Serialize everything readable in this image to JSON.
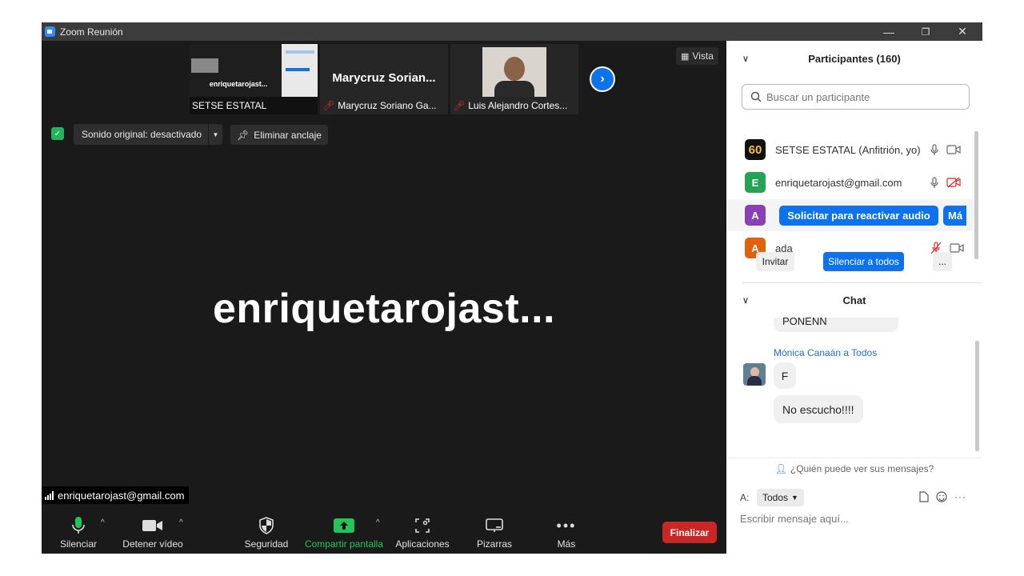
{
  "window": {
    "title": "Zoom Reunión",
    "min": "—",
    "restore": "❐",
    "close": "✕"
  },
  "gallery": {
    "thumbs": [
      {
        "caption": "SETSE ESTATAL",
        "screen_text": "enriquetarojast..."
      },
      {
        "name_big": "Marycruz  Sorian...",
        "caption": "Marycruz Soriano Ga..."
      },
      {
        "caption": "Luis Alejandro Cortes..."
      }
    ],
    "next_icon": "chevron-right-icon",
    "vista_label": "Vista"
  },
  "meeting": {
    "sonido_label": "Sonido original: desactivado",
    "anclaje_label": "Eliminar anclaje",
    "active_speaker": "enriquetarojast...",
    "name_tag": "enriquetarojast@gmail.com"
  },
  "toolbar": {
    "silenciar": "Silenciar",
    "detener_video": "Detener vídeo",
    "seguridad": "Seguridad",
    "compartir": "Compartir pantalla",
    "aplicaciones": "Aplicaciones",
    "pizarras": "Pizarras",
    "mas": "Más",
    "finalizar": "Finalizar"
  },
  "participants": {
    "header": "Participantes (160)",
    "search_placeholder": "Buscar un participante",
    "rows": [
      {
        "avatar": "60",
        "avatar_color": "#111111",
        "name": "SETSE ESTATAL (Anfitrión, yo)"
      },
      {
        "avatar": "E",
        "avatar_color": "#23a455",
        "name": "enriquetarojast@gmail.com"
      },
      {
        "avatar": "A",
        "avatar_color": "#8a3fb7",
        "action": "Solicitar para reactivar audio",
        "more": "Má"
      },
      {
        "avatar": "A",
        "avatar_color": "#e0610e",
        "name": "ada"
      }
    ],
    "invitar": "Invitar",
    "silenciar_todos": "Silenciar a todos",
    "more": "..."
  },
  "chat": {
    "header": "Chat",
    "prev_msg": "PONENN",
    "sender": "Mónica Canaán a Todos",
    "messages": [
      "F",
      "No escucho!!!!"
    ],
    "who_can_see": "¿Quién puede ver sus mensajes?",
    "to_label": "A:",
    "to_value": "Todos",
    "input_placeholder": "Escribir mensaje aquí..."
  },
  "colors": {
    "accent": "#0e72ed",
    "end": "#c92626",
    "share": "#23c45a",
    "mic": "#23c45a"
  }
}
